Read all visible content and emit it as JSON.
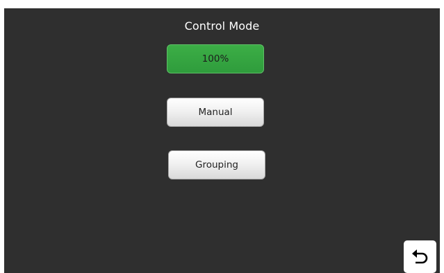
{
  "header": {
    "title": "Control Mode"
  },
  "modes": {
    "active_label": "100%",
    "manual_label": "Manual",
    "grouping_label": "Grouping"
  },
  "colors": {
    "background": "#2f2f2f",
    "active": "#34a340",
    "button": "#e8e8e8"
  },
  "icons": {
    "back": "undo-arrow-icon"
  }
}
